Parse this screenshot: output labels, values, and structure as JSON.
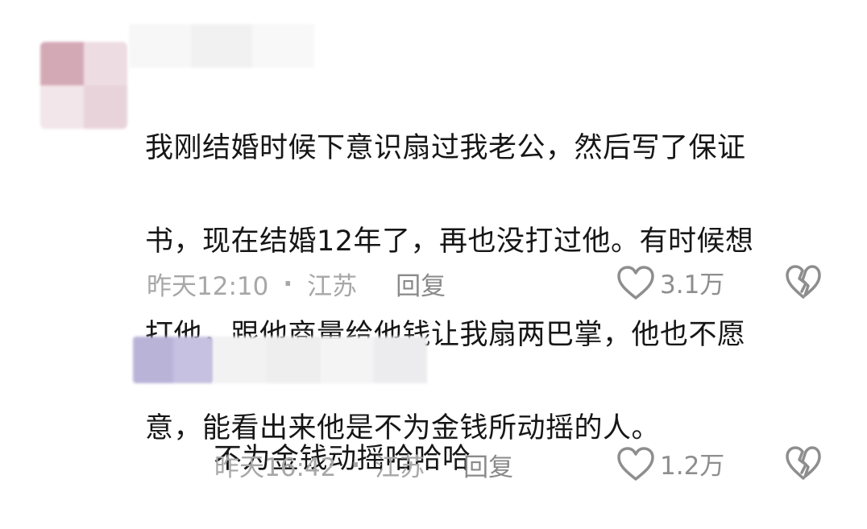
{
  "comments": [
    {
      "text": "我刚结婚时候下意识扇过我老公，然后写了保证书，现在结婚12年了，再也没打过他。有时候想打他，跟他商量给他钱让我扇两巴掌，他也不愿意，能看出来他是不为金钱所动摇的人。",
      "lines": [
        "我刚结婚时候下意识扇过我老公，然后写了保证",
        "书，现在结婚12年了，再也没打过他。有时候想",
        "打他，跟他商量给他钱让我扇两巴掌，他也不愿",
        "意，能看出来他是不为金钱所动摇的人。"
      ],
      "time": "昨天12:10",
      "separator": "·",
      "location": "江苏",
      "reply_label": "回复",
      "likes": "3.1万",
      "like_icon": "heart-icon",
      "dislike_icon": "broken-heart-icon",
      "avatar_colors": [
        "#d4a9b6",
        "#eddde2",
        "#f2e6ea",
        "#f6eef0"
      ]
    },
    {
      "text": "不为金钱动摇哈哈哈",
      "lines": [
        "不为金钱动摇哈哈哈"
      ],
      "time": "昨天16:42",
      "separator": "·",
      "location": "江苏",
      "reply_label": "回复",
      "likes": "1.2万",
      "like_icon": "heart-icon",
      "dislike_icon": "broken-heart-icon",
      "avatar_colors": [
        "#b9b3d8",
        "#cfcbe5",
        "#f0f0f2",
        "#ececee"
      ]
    }
  ]
}
